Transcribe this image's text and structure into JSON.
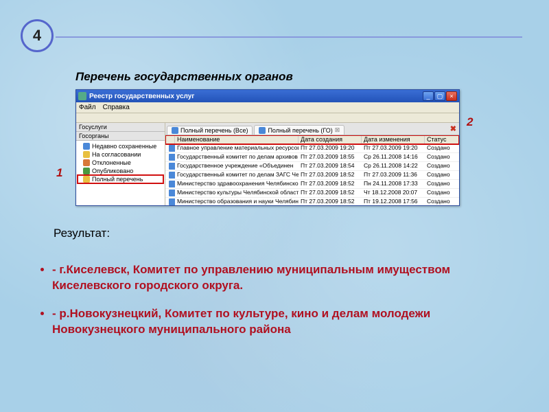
{
  "slide": {
    "number": "4",
    "heading": "Перечень государственных органов",
    "result_label": "Результат:",
    "bullets": [
      "- г.Киселевск, Комитет по управлению муниципальным имуществом Киселевского городского округа.",
      "- р.Новокузнецкий, Комитет по культуре, кино и делам молодежи Новокузнецкого  муниципального района"
    ],
    "callouts": {
      "one": "1",
      "two": "2"
    }
  },
  "window": {
    "title": "Реестр государственных услуг",
    "menu": {
      "file": "Файл",
      "help": "Справка"
    },
    "sidebar": {
      "sections": {
        "gosuslugi": "Госуслуги",
        "gosorgany": "Госорганы"
      },
      "items": [
        {
          "icon": "blue",
          "label": "Недавно сохраненные"
        },
        {
          "icon": "yel",
          "label": "На согласовании"
        },
        {
          "icon": "org",
          "label": "Отклоненные"
        },
        {
          "icon": "grn",
          "label": "Опубликовано"
        },
        {
          "icon": "yel",
          "label": "Полный перечень"
        }
      ]
    },
    "tabs": [
      {
        "label": "Полный перечень (Все)"
      },
      {
        "label": "Полный перечень (ГО)"
      }
    ],
    "grid": {
      "headers": {
        "name": "Наименование",
        "created": "Дата создания",
        "modified": "Дата изменения",
        "status": "Статус"
      },
      "rows": [
        {
          "name": "Главное управление материальных ресурсов",
          "created": "Пт 27.03.2009 19:20",
          "modified": "Пт 27.03.2009 19:20",
          "status": "Создано"
        },
        {
          "name": "Государственный комитет по делам архивов",
          "created": "Пт 27.03.2009 18:55",
          "modified": "Ср 26.11.2008 14:16",
          "status": "Создано"
        },
        {
          "name": "Государственное учреждение «Объединен",
          "created": "Пт 27.03.2009 18:54",
          "modified": "Ср 26.11.2008 14:22",
          "status": "Создано"
        },
        {
          "name": "Государственный комитет по делам ЗАГС Чел",
          "created": "Пт 27.03.2009 18:52",
          "modified": "Пт 27.03.2009 11:36",
          "status": "Создано"
        },
        {
          "name": "Министерство здравоохранения Челябинской",
          "created": "Пт 27.03.2009 18:52",
          "modified": "Пн 24.11.2008 17:33",
          "status": "Создано"
        },
        {
          "name": "Министерство культуры Челябинской области",
          "created": "Пт 27.03.2009 18:52",
          "modified": "Чт 18.12.2008 20:07",
          "status": "Создано"
        },
        {
          "name": "Министерство образования и науки Челябинс",
          "created": "Пт 27.03.2009 18:52",
          "modified": "Пт 19.12.2008 17:56",
          "status": "Создано"
        }
      ]
    }
  }
}
